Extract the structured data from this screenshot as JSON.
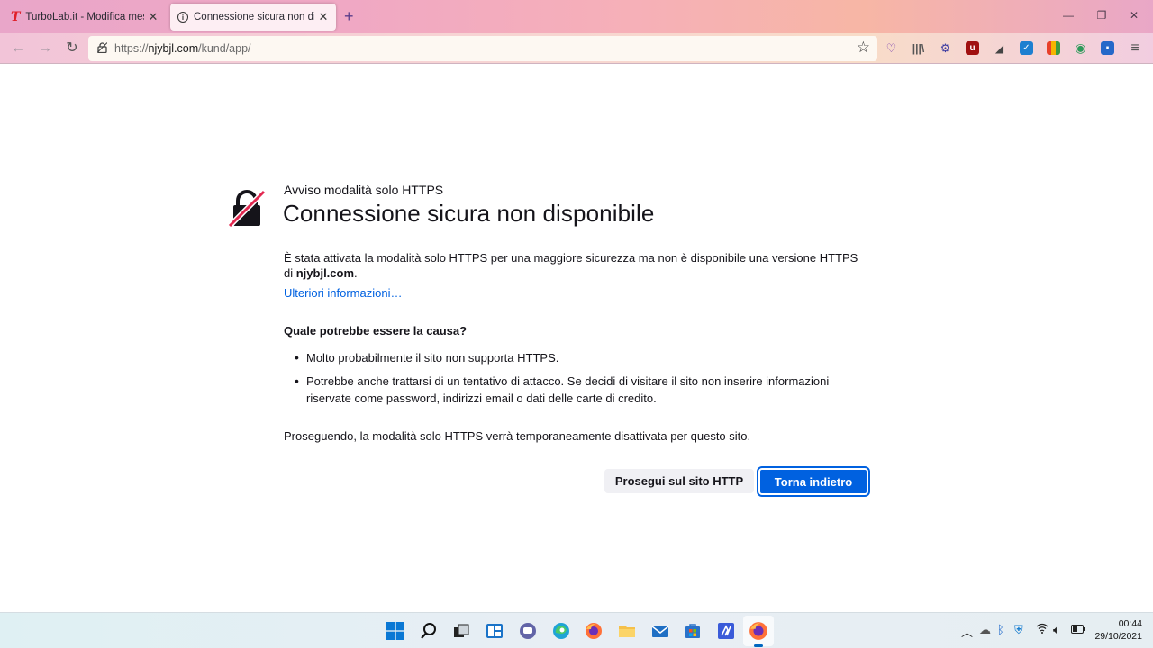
{
  "browser": {
    "tabs": [
      {
        "label": "TurboLab.it - Modifica messaggio",
        "favicon": "turbolab-t-icon",
        "active": false
      },
      {
        "label": "Connessione sicura non disponibile",
        "favicon": "info-icon",
        "active": true
      }
    ],
    "url": {
      "prefix": "https://",
      "domain": "njybjl.com",
      "path": "/kund/app/"
    }
  },
  "page": {
    "subtitle": "Avviso modalità solo HTTPS",
    "title": "Connessione sicura non disponibile",
    "intro_text": "È stata attivata la modalità solo HTTPS per una maggiore sicurezza ma non è disponibile una versione HTTPS di ",
    "intro_domain": "njybjl.com",
    "intro_end": ".",
    "learn_more": "Ulteriori informazioni…",
    "cause_heading": "Quale potrebbe essere la causa?",
    "causes": [
      "Molto probabilmente il sito non supporta HTTPS.",
      "Potrebbe anche trattarsi di un tentativo di attacco. Se decidi di visitare il sito non inserire informazioni riservate come password, indirizzi email o dati delle carte di credito."
    ],
    "continue_note": "Proseguendo, la modalità solo HTTPS verrà temporaneamente disattivata per questo sito.",
    "btn_continue_http": "Prosegui sul sito HTTP",
    "btn_go_back": "Torna indietro"
  },
  "taskbar": {
    "time": "00:44",
    "date": "29/10/2021"
  },
  "colors": {
    "accent": "#0061e0",
    "warning_slash": "#e22850"
  }
}
